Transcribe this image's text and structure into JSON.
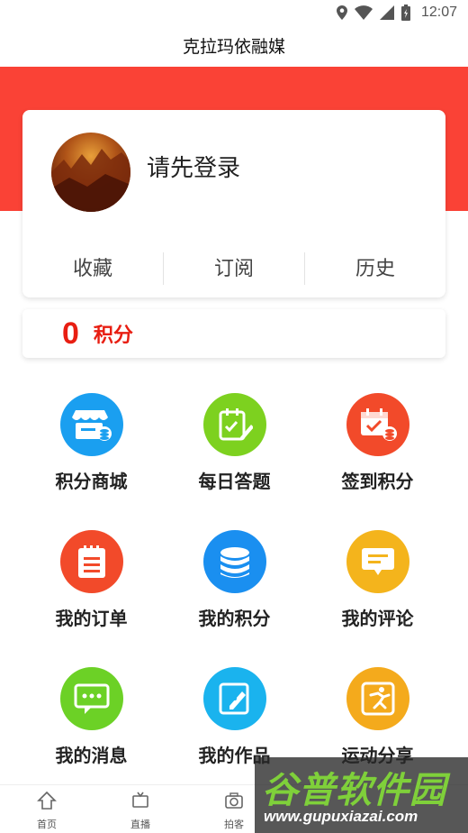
{
  "status_bar": {
    "time": "12:07",
    "icons": [
      "location-icon",
      "wifi-icon",
      "signal-icon",
      "battery-icon"
    ]
  },
  "header": {
    "title": "克拉玛依融媒"
  },
  "colors": {
    "brand_red": "#fa4236",
    "points_red": "#e81e12"
  },
  "profile": {
    "login_prompt": "请先登录",
    "stats": [
      {
        "label": "收藏"
      },
      {
        "label": "订阅"
      },
      {
        "label": "历史"
      }
    ]
  },
  "points": {
    "value": "0",
    "label": "积分"
  },
  "grid": {
    "items": [
      {
        "label": "积分商城",
        "icon": "store-icon",
        "color": "#1a9ff0"
      },
      {
        "label": "每日答题",
        "icon": "quiz-icon",
        "color": "#7dd11f"
      },
      {
        "label": "签到积分",
        "icon": "checkin-icon",
        "color": "#f24a2a"
      },
      {
        "label": "我的订单",
        "icon": "order-icon",
        "color": "#f24a2a"
      },
      {
        "label": "我的积分",
        "icon": "coins-icon",
        "color": "#1a8ff0"
      },
      {
        "label": "我的评论",
        "icon": "comment-icon",
        "color": "#f4b41c"
      },
      {
        "label": "我的消息",
        "icon": "message-icon",
        "color": "#6cd126"
      },
      {
        "label": "我的作品",
        "icon": "works-icon",
        "color": "#1ab3ee"
      },
      {
        "label": "运动分享",
        "icon": "sport-icon",
        "color": "#f4aa1c"
      }
    ]
  },
  "bottom_nav": {
    "items": [
      {
        "label": "首页",
        "icon": "home-icon"
      },
      {
        "label": "直播",
        "icon": "tv-icon"
      },
      {
        "label": "拍客",
        "icon": "camera-icon"
      }
    ]
  },
  "watermark": {
    "main": "谷普软件园",
    "sub": "www.gupuxiazai.com"
  }
}
